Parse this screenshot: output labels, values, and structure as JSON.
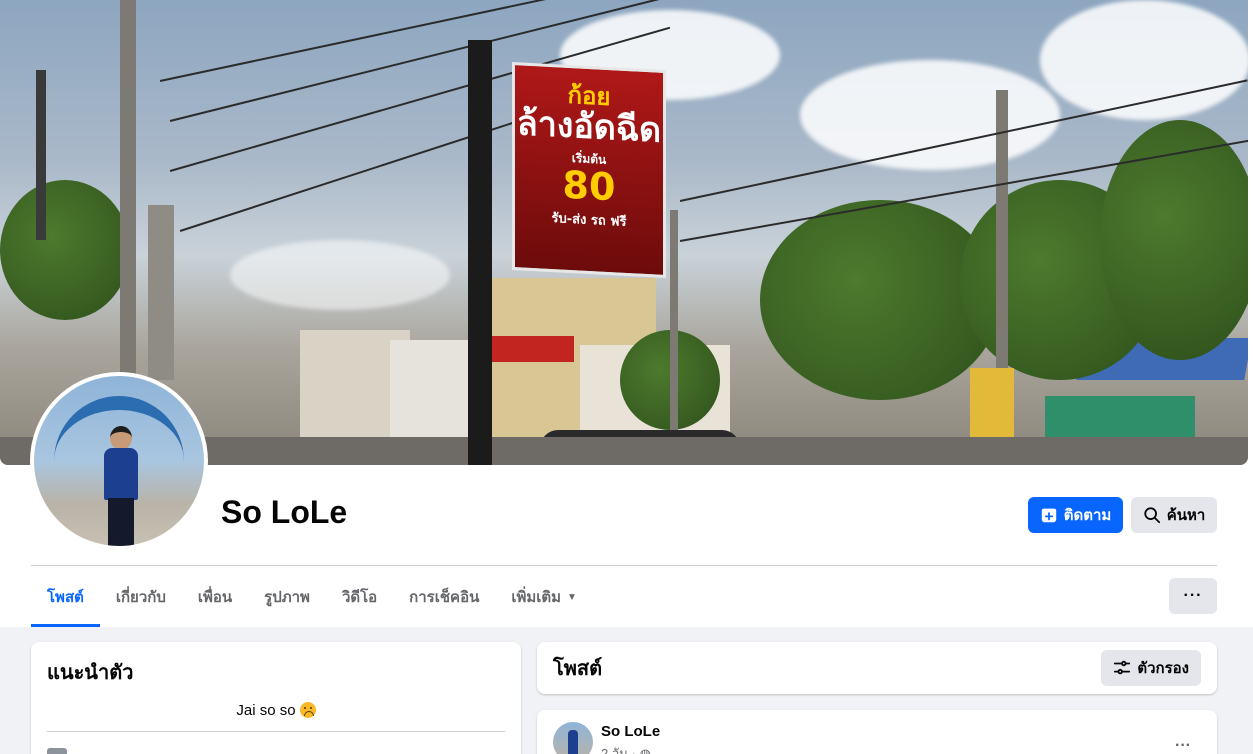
{
  "profile": {
    "name": "So LoLe"
  },
  "cover": {
    "sign_line1": "ก้อย",
    "sign_line2": "ล้างอัดฉีด",
    "sign_line3": "เริ่มต้น",
    "sign_line4": "80",
    "sign_line5": "รับ-ส่ง รถ ฟรี"
  },
  "actions": {
    "follow_label": "ติดตาม",
    "search_label": "ค้นหา",
    "more_label": "···"
  },
  "tabs": [
    {
      "label": "โพสต์",
      "active": true
    },
    {
      "label": "เกี่ยวกับ"
    },
    {
      "label": "เพื่อน"
    },
    {
      "label": "รูปภาพ"
    },
    {
      "label": "วิดีโอ"
    },
    {
      "label": "การเช็คอิน"
    },
    {
      "label": "เพิ่มเติม"
    }
  ],
  "intro": {
    "title": "แนะนำตัว",
    "bio": "Jai so so"
  },
  "posts_header": {
    "title": "โพสต์",
    "filter_label": "ตัวกรอง"
  },
  "post": {
    "author": "So LoLe",
    "meta": "2 วัน ·",
    "more_label": "···"
  },
  "colors": {
    "accent": "#0866ff",
    "button_gray": "#e4e6eb",
    "page_bg": "#f0f2f5",
    "secondary_text": "#65676b"
  }
}
